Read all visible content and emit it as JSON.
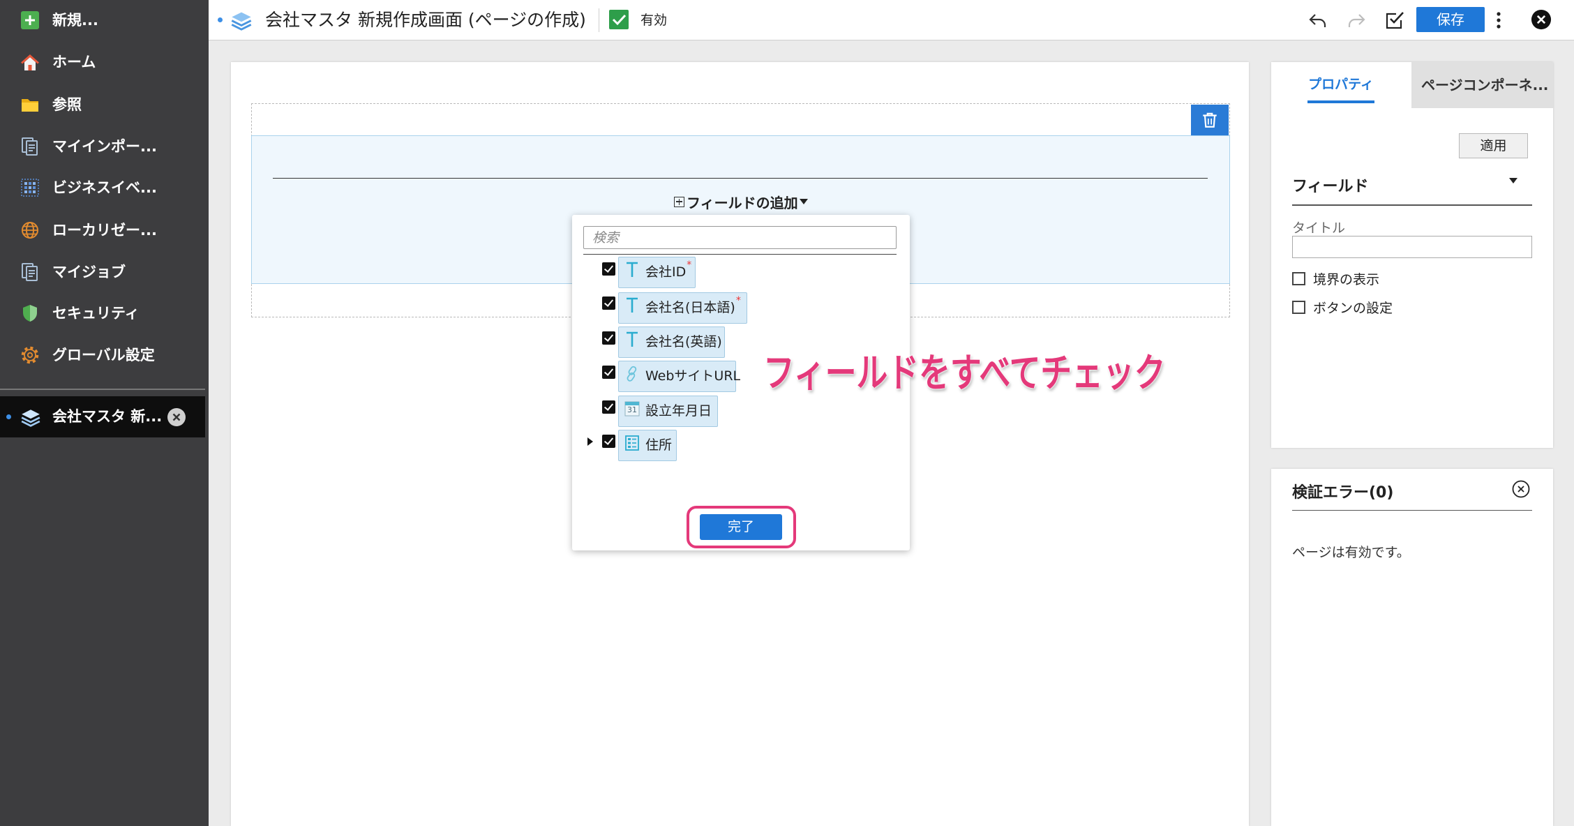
{
  "sidebar": {
    "items": [
      {
        "label": "新規...",
        "icon": "plus-icon"
      },
      {
        "label": "ホーム",
        "icon": "home-icon"
      },
      {
        "label": "参照",
        "icon": "folder-icon"
      },
      {
        "label": "マイインポー...",
        "icon": "document-stack-icon"
      },
      {
        "label": "ビジネスイベ...",
        "icon": "business-grid-icon"
      },
      {
        "label": "ローカリゼー...",
        "icon": "globe-icon"
      },
      {
        "label": "マイジョブ",
        "icon": "document-stack-icon"
      },
      {
        "label": "セキュリティ",
        "icon": "shield-icon"
      },
      {
        "label": "グローバル設定",
        "icon": "gear-icon"
      }
    ],
    "open_tab": {
      "label": "会社マスタ 新...",
      "icon": "layers-icon"
    }
  },
  "header": {
    "title": "会社マスタ 新規作成画面 (ページの作成)",
    "enabled_checked": true,
    "enabled_label": "有効",
    "save_label": "保存",
    "icons": [
      "undo-icon",
      "redo-icon",
      "validate-check-icon",
      "more-vertical-icon",
      "close-icon"
    ]
  },
  "canvas": {
    "add_field_label": "フィールドの追加"
  },
  "field_picker": {
    "search_placeholder": "検索",
    "fields": [
      {
        "label": "会社ID",
        "required_mark": "*",
        "type_icon": "text-icon",
        "checked": true
      },
      {
        "label": "会社名(日本語)",
        "required_mark": "*",
        "type_icon": "text-icon",
        "checked": true
      },
      {
        "label": "会社名(英語)",
        "type_icon": "text-icon",
        "checked": true
      },
      {
        "label": "WebサイトURL",
        "type_icon": "link-icon",
        "checked": true
      },
      {
        "label": "設立年月日",
        "type_icon": "calendar-icon",
        "icon_text": "31",
        "checked": true
      },
      {
        "label": "住所",
        "type_icon": "group-icon",
        "checked": true,
        "expandable": true
      }
    ],
    "done_label": "完了"
  },
  "annotation": {
    "text": "フィールドをすべてチェック"
  },
  "properties_panel": {
    "tabs": [
      {
        "label": "プロパティ",
        "active": true
      },
      {
        "label": "ページコンポーネ...",
        "active": false
      }
    ],
    "apply_label": "適用",
    "section_title": "フィールド",
    "title_label": "タイトル",
    "title_value": "",
    "checkboxes": [
      {
        "label": "境界の表示",
        "checked": false
      },
      {
        "label": "ボタンの設定",
        "checked": false
      }
    ]
  },
  "validation_panel": {
    "title": "検証エラー(0)",
    "message": "ページは有効です。"
  },
  "colors": {
    "accent": "#1f78d8",
    "annotation": "#e4397a",
    "sidebar_bg": "#3d3d3f",
    "enabled_green": "#2e9e4a",
    "field_icon": "#2aaccf"
  }
}
